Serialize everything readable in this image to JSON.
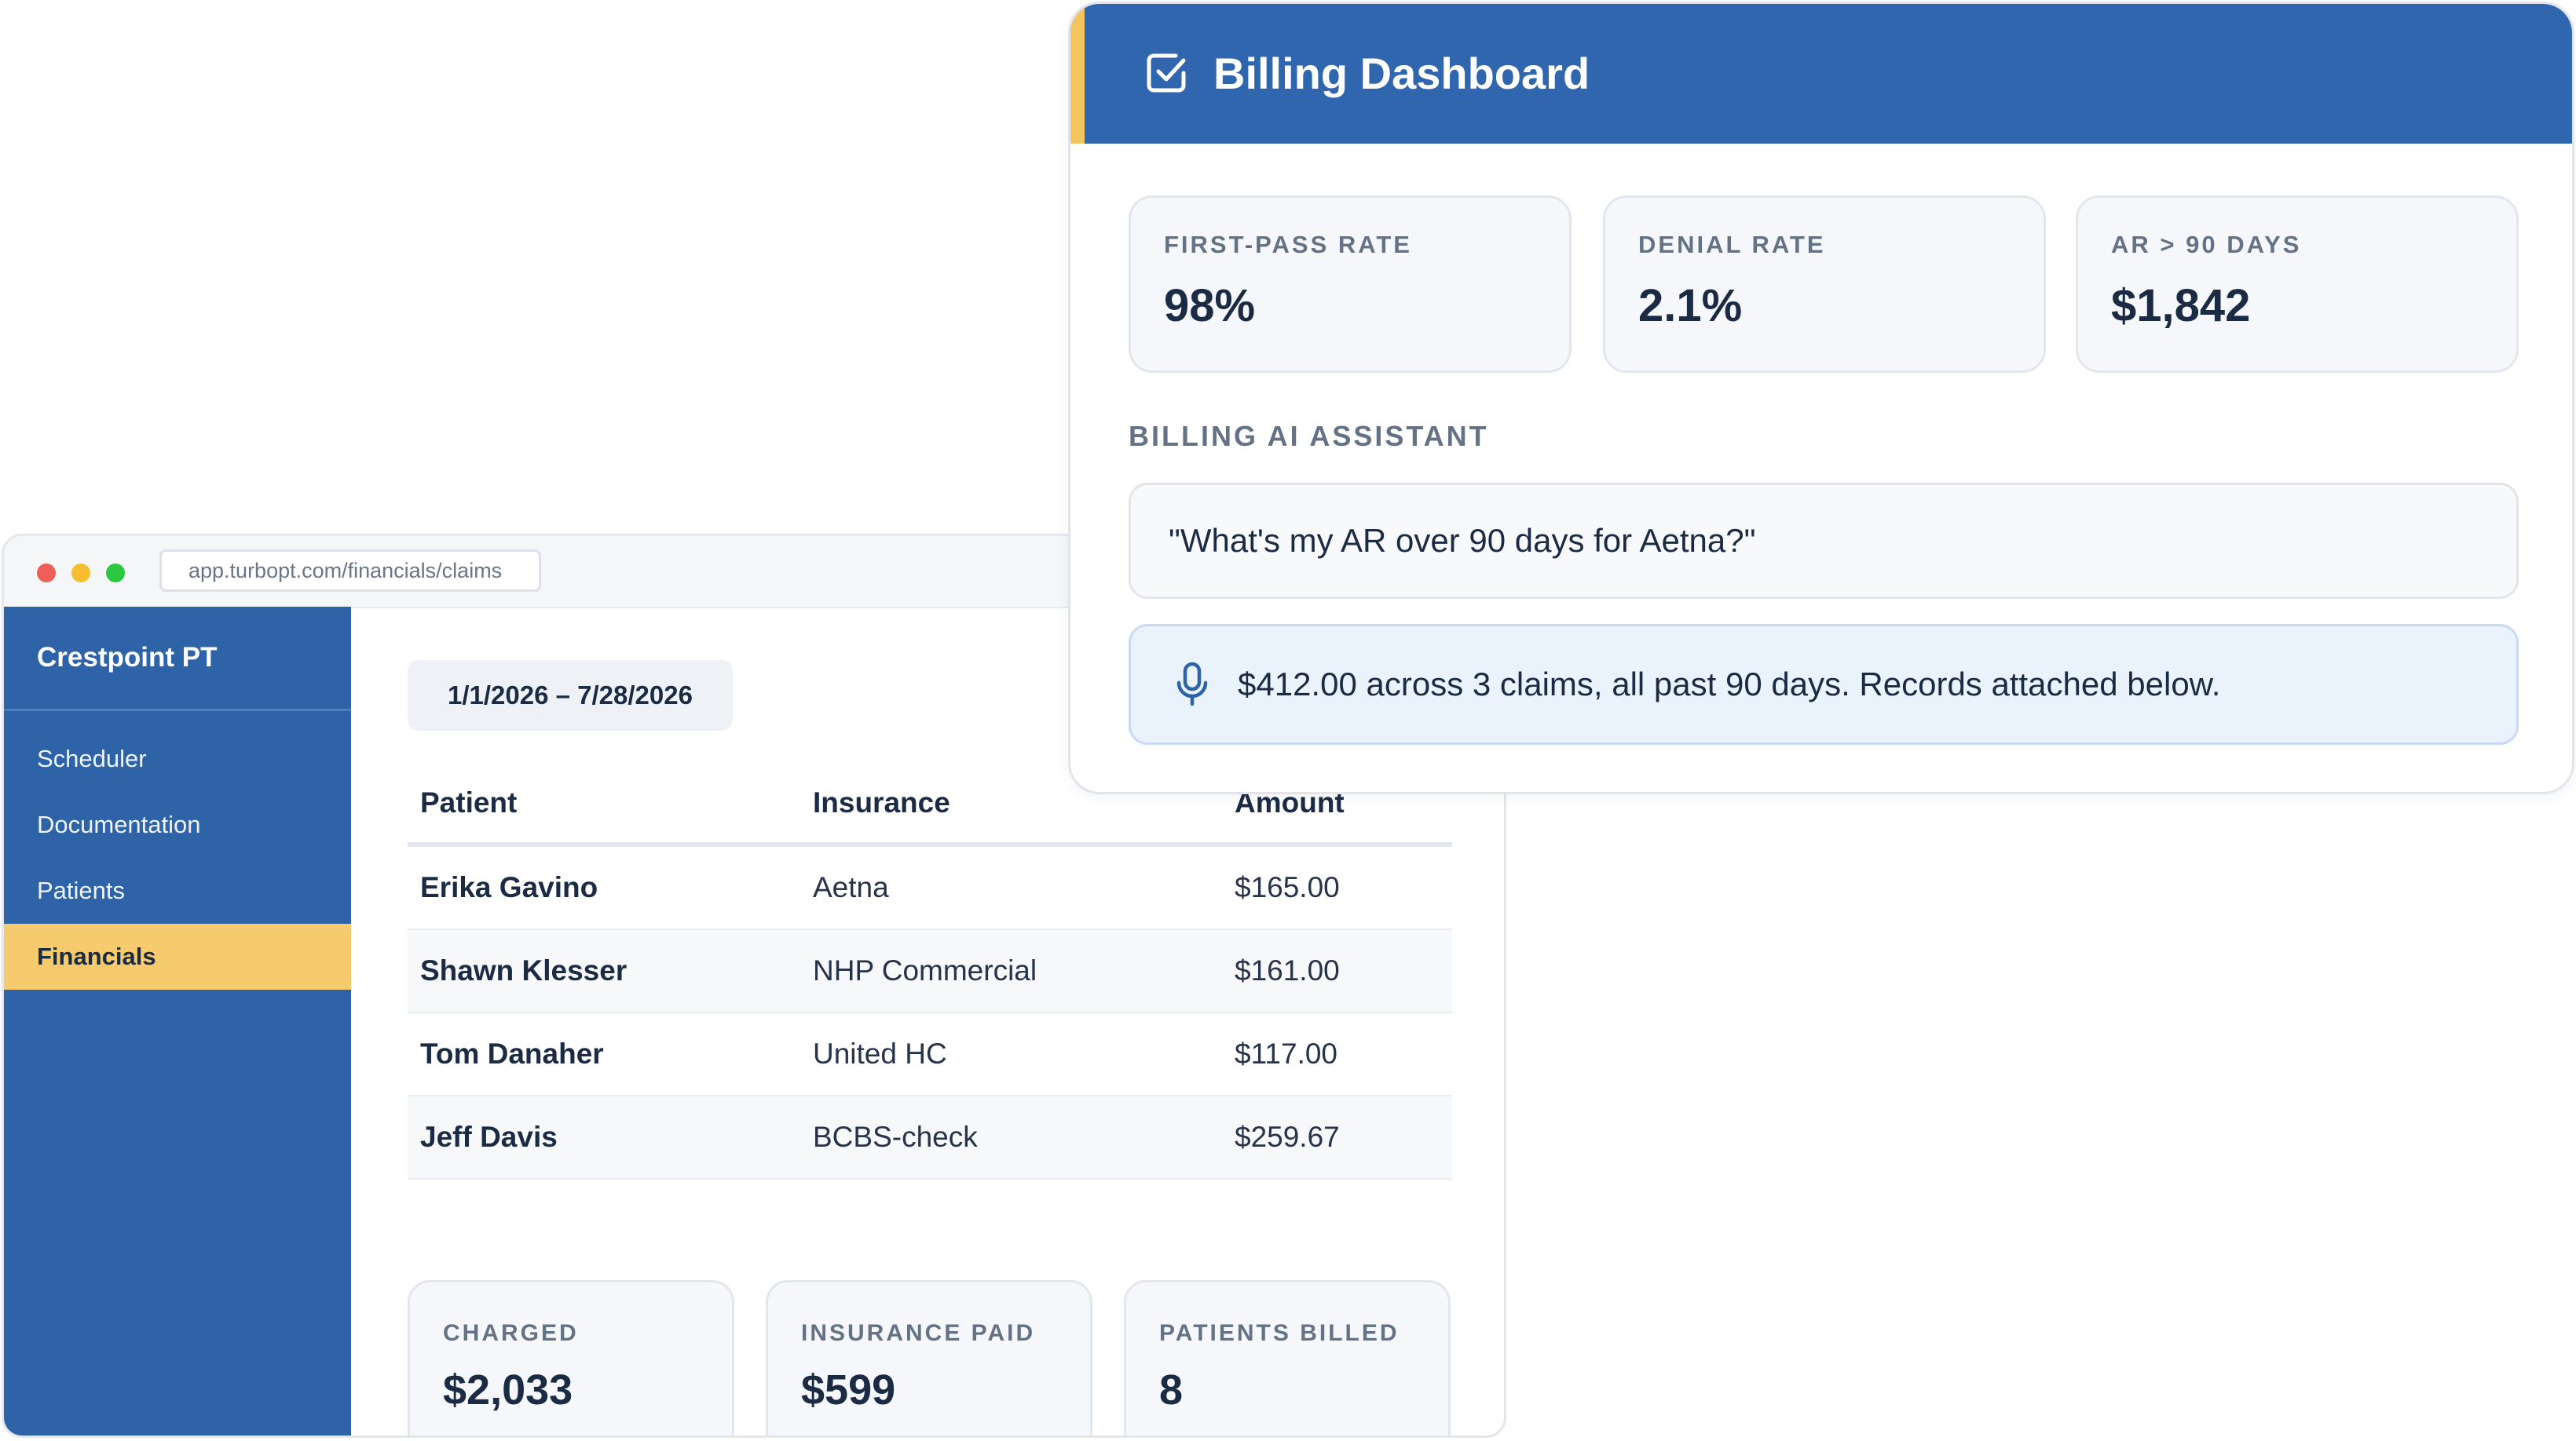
{
  "browser": {
    "url": "app.turbopt.com/financials/claims"
  },
  "sidebar": {
    "brand": "Crestpoint PT",
    "items": [
      {
        "label": "Scheduler",
        "active": false
      },
      {
        "label": "Documentation",
        "active": false
      },
      {
        "label": "Patients",
        "active": false
      },
      {
        "label": "Financials",
        "active": true
      }
    ]
  },
  "main": {
    "date_range": "1/1/2026 – 7/28/2026",
    "table": {
      "headers": [
        "Patient",
        "Insurance",
        "Amount"
      ],
      "rows": [
        {
          "patient": "Erika Gavino",
          "insurance": "Aetna",
          "amount": "$165.00"
        },
        {
          "patient": "Shawn Klesser",
          "insurance": "NHP Commercial",
          "amount": "$161.00"
        },
        {
          "patient": "Tom Danaher",
          "insurance": "United HC",
          "amount": "$117.00"
        },
        {
          "patient": "Jeff Davis",
          "insurance": "BCBS-check",
          "amount": "$259.67"
        }
      ]
    },
    "stats": [
      {
        "label": "CHARGED",
        "value": "$2,033"
      },
      {
        "label": "INSURANCE PAID",
        "value": "$599"
      },
      {
        "label": "PATIENTS BILLED",
        "value": "8"
      }
    ]
  },
  "dashboard": {
    "title": "Billing Dashboard",
    "icon": "checkbox-icon",
    "metrics": [
      {
        "label": "FIRST-PASS RATE",
        "value": "98%"
      },
      {
        "label": "DENIAL RATE",
        "value": "2.1%"
      },
      {
        "label": "AR > 90 DAYS",
        "value": "$1,842"
      }
    ],
    "assistant": {
      "title": "BILLING AI ASSISTANT",
      "query": "\"What's my AR over 90 days for Aetna?\"",
      "answer": "$412.00 across 3 claims, all past 90 days. Records attached below.",
      "answer_icon": "microphone-icon"
    }
  },
  "colors": {
    "brand_blue": "#2e63a8",
    "accent_yellow": "#f6cb6d",
    "text_dark": "#1c2b44",
    "label_gray": "#647285",
    "answer_bg": "#eaf2fc"
  }
}
